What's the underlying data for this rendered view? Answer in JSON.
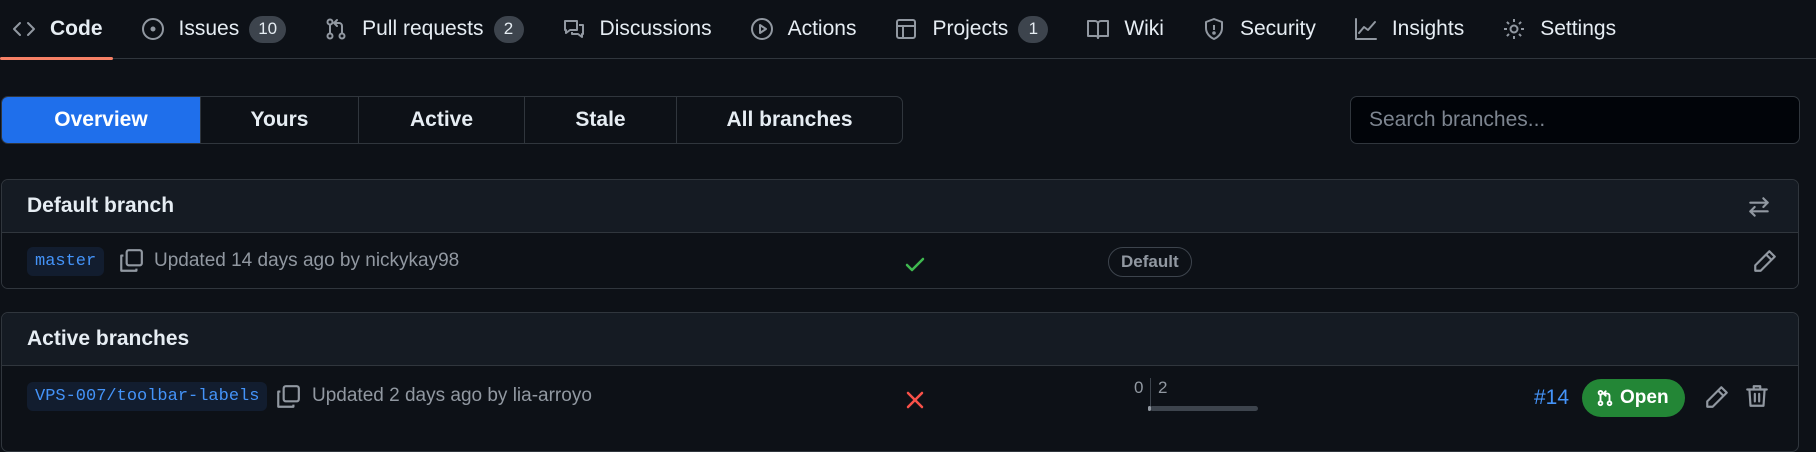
{
  "repo_nav": {
    "items": [
      {
        "label": "Code",
        "icon": "code-icon",
        "selected": true,
        "counter": null
      },
      {
        "label": "Issues",
        "icon": "issue-opened-icon",
        "selected": false,
        "counter": "10"
      },
      {
        "label": "Pull requests",
        "icon": "git-pull-request-icon",
        "selected": false,
        "counter": "2"
      },
      {
        "label": "Discussions",
        "icon": "comment-discussion-icon",
        "selected": false,
        "counter": null
      },
      {
        "label": "Actions",
        "icon": "play-icon",
        "selected": false,
        "counter": null
      },
      {
        "label": "Projects",
        "icon": "table-icon",
        "selected": false,
        "counter": "1"
      },
      {
        "label": "Wiki",
        "icon": "book-icon",
        "selected": false,
        "counter": null
      },
      {
        "label": "Security",
        "icon": "shield-icon",
        "selected": false,
        "counter": null
      },
      {
        "label": "Insights",
        "icon": "graph-icon",
        "selected": false,
        "counter": null
      },
      {
        "label": "Settings",
        "icon": "gear-icon",
        "selected": false,
        "counter": null
      }
    ]
  },
  "filter_tabs": [
    {
      "label": "Overview",
      "selected": true
    },
    {
      "label": "Yours",
      "selected": false
    },
    {
      "label": "Active",
      "selected": false
    },
    {
      "label": "Stale",
      "selected": false
    },
    {
      "label": "All branches",
      "selected": false
    }
  ],
  "search": {
    "placeholder": "Search branches..."
  },
  "default_section": {
    "title": "Default branch",
    "header_icon": "arrow-switch-icon",
    "branch": {
      "name": "master",
      "updated": "Updated 14 days ago by nickykay98",
      "check_status": "success",
      "label": "Default",
      "actions": [
        "pencil-icon"
      ]
    }
  },
  "active_section": {
    "title": "Active branches",
    "branch": {
      "name": "VPS-007/toolbar-labels",
      "updated": "Updated 2 days ago by lia-arroyo",
      "check_status": "failure",
      "behind": "0",
      "ahead": "2",
      "pr_number": "#14",
      "pr_state": "Open",
      "actions": [
        "pencil-icon",
        "trash-icon"
      ]
    }
  },
  "colors": {
    "background": "#0d1117",
    "selected_tab": "#1f6feb",
    "link": "#4493f8",
    "success": "#3fb950",
    "failure": "#f85149",
    "open_pr": "#238636",
    "nav_underline": "#f78166"
  }
}
